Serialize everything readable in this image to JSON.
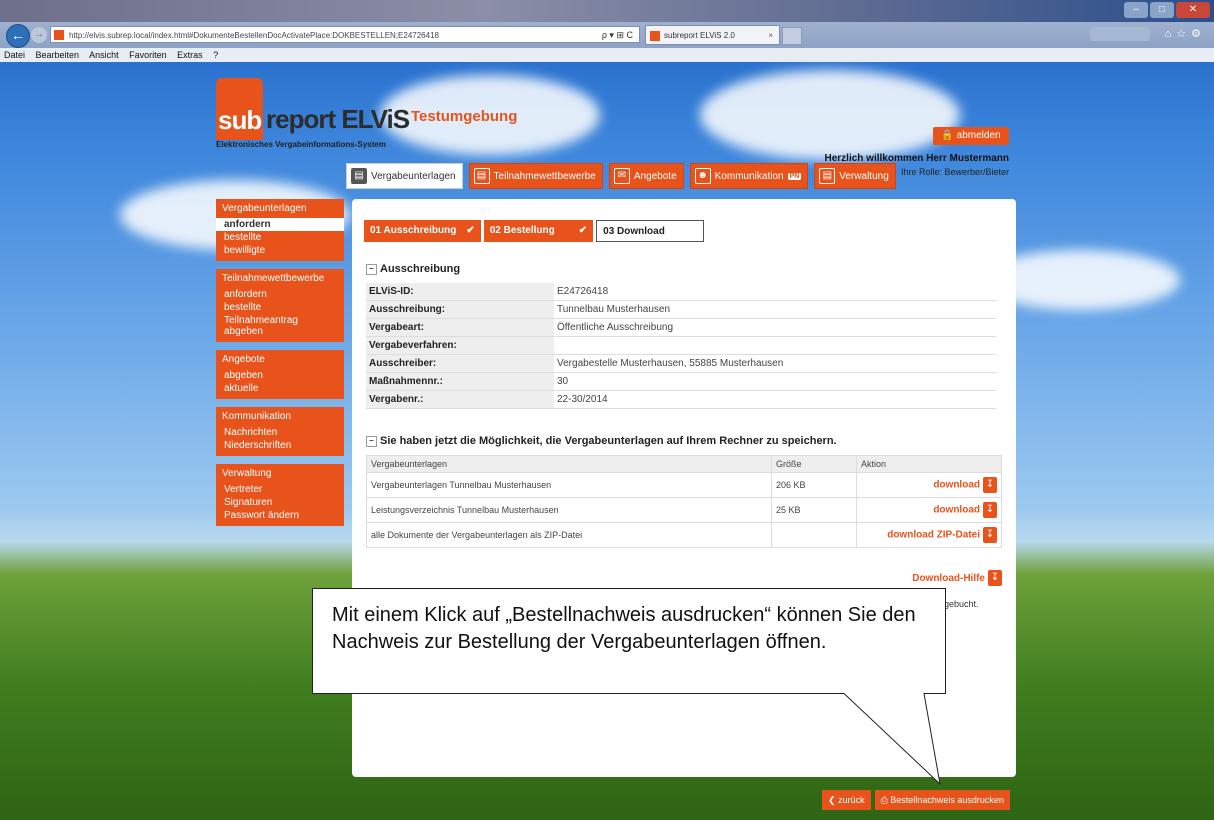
{
  "browser": {
    "window_title": "",
    "url": "http://elvis.subrep.local/index.html#DokumenteBestellenDocActivatePlace:DOKBESTELLEN;E24726418",
    "address_controls": "ρ ▾ ⊞ C",
    "tab_title": "subreport ELViS 2.0",
    "tab_close": "×",
    "menu": [
      "Datei",
      "Bearbeiten",
      "Ansicht",
      "Favoriten",
      "Extras",
      "?"
    ]
  },
  "header": {
    "logo_sub": "sub",
    "logo_rest": "report ELViS",
    "logo_tagline": "Elektronisches Vergabeinformations-System",
    "environment": "Testumgebung",
    "logout_label": "abmelden",
    "welcome": "Herzlich willkommen Herr Mustermann",
    "role": "Ihre Rolle: Bewerber/Bieter"
  },
  "nav": [
    {
      "label": "Vergabeunterlagen",
      "icon": "document-icon",
      "active": true
    },
    {
      "label": "Teilnahmewettbewerbe",
      "icon": "form-icon",
      "active": false
    },
    {
      "label": "Angebote",
      "icon": "offer-icon",
      "active": false
    },
    {
      "label": "Kommunikation",
      "icon": "user-icon",
      "active": false,
      "badge": "PN"
    },
    {
      "label": "Verwaltung",
      "icon": "admin-icon",
      "active": false
    }
  ],
  "sidebar": [
    {
      "head": "Vergabeunterlagen",
      "links": [
        "anfordern",
        "bestellte",
        "bewilligte"
      ],
      "active": "anfordern"
    },
    {
      "head": "Teilnahmewettbewerbe",
      "links": [
        "anfordern",
        "bestellte",
        "Teilnahmeantrag abgeben"
      ]
    },
    {
      "head": "Angebote",
      "links": [
        "abgeben",
        "aktuelle"
      ]
    },
    {
      "head": "Kommunikation",
      "links": [
        "Nachrichten",
        "Niederschriften"
      ]
    },
    {
      "head": "Verwaltung",
      "links": [
        "Vertreter",
        "Signaturen",
        "Passwort ändern"
      ]
    }
  ],
  "steps": [
    {
      "label": "01 Ausschreibung",
      "done": true
    },
    {
      "label": "02 Bestellung",
      "done": true
    },
    {
      "label": "03 Download",
      "done": false
    }
  ],
  "ausschreibung": {
    "heading": "Ausschreibung",
    "rows": [
      {
        "k": "ELViS-ID:",
        "v": "E24726418"
      },
      {
        "k": "Ausschreibung:",
        "v": "Tunnelbau Musterhausen"
      },
      {
        "k": "Vergabeart:",
        "v": "Öffentliche Ausschreibung"
      },
      {
        "k": "Vergabeverfahren:",
        "v": ""
      },
      {
        "k": "Ausschreiber:",
        "v": "Vergabestelle Musterhausen, 55885 Musterhausen"
      },
      {
        "k": "Maßnahmennr.:",
        "v": "30"
      },
      {
        "k": "Vergabenr.:",
        "v": "22-30/2014"
      }
    ]
  },
  "downloads": {
    "heading": "Sie haben jetzt die Möglichkeit, die Vergabeunterlagen auf Ihrem Rechner zu speichern.",
    "columns": [
      "Vergabeunterlagen",
      "Größe",
      "Aktion"
    ],
    "rows": [
      {
        "name": "Vergabeunterlagen Tunnelbau Musterhausen",
        "size": "206 KB",
        "action": "download"
      },
      {
        "name": "Leistungsverzeichnis Tunnelbau Musterhausen",
        "size": "25 KB",
        "action": "download"
      },
      {
        "name": "alle Dokumente der Vergabeunterlagen als ZIP-Datei",
        "size": "",
        "action": "download ZIP-Datei"
      }
    ],
    "help_label": "Download-Hilfe",
    "partial_text": "gebucht."
  },
  "footer_buttons": {
    "back": "zurück",
    "print": "Bestellnachweis ausdrucken"
  },
  "callout": {
    "text": "Mit einem Klick auf „Bestellnachweis ausdrucken“ können Sie den Nachweis zur Bestellung der Vergabeunterlagen öffnen."
  },
  "colors": {
    "accent": "#e8531c"
  }
}
